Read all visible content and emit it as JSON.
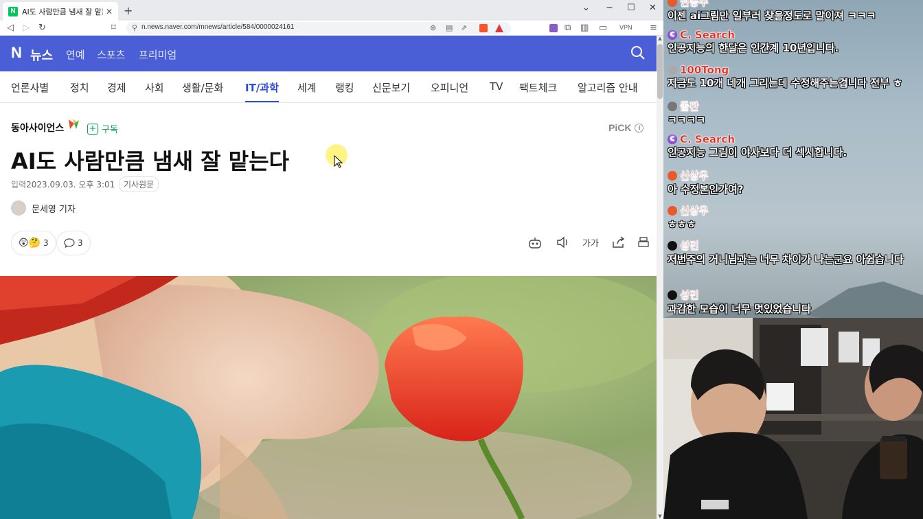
{
  "browser": {
    "tab_title": "AI도 사람만큼 냄새 잘 맡는다",
    "favicon": "N",
    "url": "n.news.naver.com/mnews/article/584/0000024161",
    "vpn_label": "VPN"
  },
  "naver": {
    "logo": "N",
    "brand": "뉴스",
    "links": [
      "연예",
      "스포츠",
      "프리미엄"
    ]
  },
  "categories": [
    "언론사별",
    "정치",
    "경제",
    "사회",
    "생활/문화",
    "IT/과학",
    "세계",
    "랭킹",
    "신문보기",
    "오피니언",
    "TV",
    "팩트체크",
    "알고리즘 안내"
  ],
  "active_category": "IT/과학",
  "article": {
    "press": "동아사이언스",
    "subscribe": "구독",
    "pick": "PiCK",
    "pick_info": "i",
    "headline": "AI도 사람만큼 냄새 잘 맡는다",
    "date_label": "입력",
    "date": "2023.09.03. 오후 3:01",
    "original_link": "기사원문",
    "reporter": "문세영 기자",
    "reaction_count": "3",
    "comment_count": "3",
    "font_tool": "가가"
  },
  "chat": [
    {
      "nick": "권승수",
      "text": "이젠 ai그림만 일부러 찾을정도로 말이져 ㅋㅋㅋ",
      "badge_color": "#e85a2a"
    },
    {
      "nick": "C. Search",
      "text": "인공지능의 한달은 인간계 10년입니다.",
      "badge_color": "#8a4fd6"
    },
    {
      "nick": "100Tong",
      "text": "지금도 10개 네개 그리는데 수정해주는겁니다 전부 ㅎ",
      "badge_color": "#aaaaaa"
    },
    {
      "nick": "돌판",
      "text": "ㅋㅋㅋㅋ",
      "badge_color": "#777777"
    },
    {
      "nick": "C. Search",
      "text": "인공지능 그림이 야사보다 더 섹시합니다.",
      "badge_color": "#8a4fd6"
    },
    {
      "nick": "신상우",
      "text": "아 수정본인가여?",
      "badge_color": "#e85a2a"
    },
    {
      "nick": "신상우",
      "text": "ㅎㅎㅎ",
      "badge_color": "#e85a2a"
    },
    {
      "nick": "성민",
      "text": "저번주의 거니님과는 너무 차이가 나는군요 아쉽습니다",
      "badge_color": "#111111"
    },
    {
      "nick": "성민",
      "text": "과감한 모습이 너무 멋있었습니다",
      "badge_color": "#111111"
    }
  ],
  "colors": {
    "naver_header": "#4a5fd6",
    "active_tab": "#2c4bd6",
    "subscribe_green": "#03a94d",
    "chat_nick": "#e8291a"
  }
}
